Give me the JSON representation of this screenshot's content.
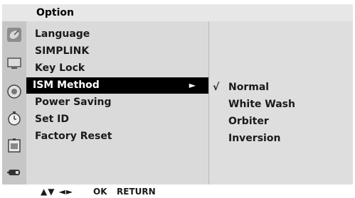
{
  "menu_title": "Option",
  "icons": [
    "satellite-dish-icon",
    "tv-screen-icon",
    "speaker-icon",
    "clock-icon",
    "lock-icon",
    "remote-input-icon"
  ],
  "menu": {
    "items": [
      {
        "label": "Language"
      },
      {
        "label": "SIMPLINK"
      },
      {
        "label": "Key Lock"
      },
      {
        "label": "ISM Method",
        "arrow": "►"
      },
      {
        "label": "Power Saving"
      },
      {
        "label": "Set ID"
      },
      {
        "label": "Factory Reset"
      }
    ],
    "selected": "ISM Method"
  },
  "submenu": {
    "check_mark": "√",
    "options": [
      "Normal",
      "White Wash",
      "Orbiter",
      "Inversion"
    ],
    "selected": "Normal"
  },
  "footer": {
    "nav_arrows": "▲▼ ◄►",
    "ok_label": "OK",
    "return_label": "RETURN"
  },
  "colors": {
    "highlight_bg": "#000000",
    "highlight_text": "#ffffff",
    "menu_bg": "#dadada",
    "icon_col_bg": "#c6c6c6"
  }
}
